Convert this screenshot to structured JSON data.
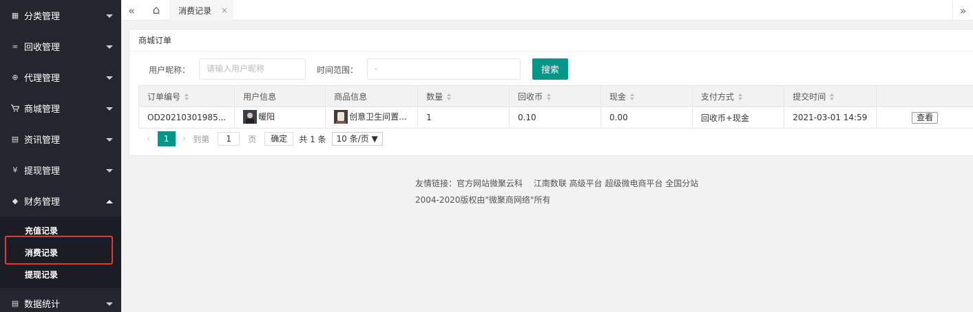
{
  "sidebar": {
    "items": [
      {
        "label": "分类管理",
        "icon": "grid-icon",
        "glyph": "▦"
      },
      {
        "label": "回收管理",
        "icon": "infinity-icon",
        "glyph": "∞"
      },
      {
        "label": "代理管理",
        "icon": "plus-circle-icon",
        "glyph": "⊕"
      },
      {
        "label": "商城管理",
        "icon": "cart-icon",
        "glyph": "🛒"
      },
      {
        "label": "资讯管理",
        "icon": "document-icon",
        "glyph": "▤"
      },
      {
        "label": "提现管理",
        "icon": "yen-circle-icon",
        "glyph": "¥"
      },
      {
        "label": "财务管理",
        "icon": "diamond-icon",
        "glyph": "◆"
      }
    ],
    "finance_sub": [
      "充值记录",
      "消费记录",
      "提现记录"
    ],
    "last_item": {
      "label": "数据统计",
      "icon": "document-icon",
      "glyph": "▤"
    }
  },
  "topbar": {
    "collapse_glyph": "«",
    "home_glyph": "⌂",
    "tab_label": "消费记录",
    "tab_close": "×",
    "expand_glyph": "»"
  },
  "card": {
    "title": "商城订单",
    "nickname_label": "用户昵称：",
    "nickname_placeholder": "请输入用户昵称",
    "time_label": "时间范围：",
    "time_value": "-",
    "search_label": "搜索"
  },
  "table": {
    "headers": [
      "订单编号",
      "用户信息",
      "商品信息",
      "数量",
      "回收币",
      "现金",
      "支付方式",
      "提交时间",
      ""
    ],
    "rows": [
      {
        "order_no": "OD20210301985...",
        "user": "暖阳",
        "product": "创意卫生间置...",
        "qty": "1",
        "coin": "0.10",
        "cash": "0.00",
        "pay": "回收币+现金",
        "time": "2021-03-01 14:59",
        "action": "查看"
      }
    ]
  },
  "pager": {
    "prev": "‹",
    "current": "1",
    "next": "›",
    "goto_label": "到第",
    "page_input": "1",
    "page_unit": "页",
    "confirm": "确定",
    "total": "共 1 条",
    "page_size": "10 条/页 ▼"
  },
  "footer": {
    "links_line": "友情链接：官方网站微聚云科　 江南数联 高级平台 超级微电商平台 全国分站",
    "copyright": "2004-2020版权由\"微聚商网络\"所有"
  },
  "colors": {
    "primary": "#009688",
    "sidebar": "#23262e",
    "highlight": "#e53935"
  }
}
